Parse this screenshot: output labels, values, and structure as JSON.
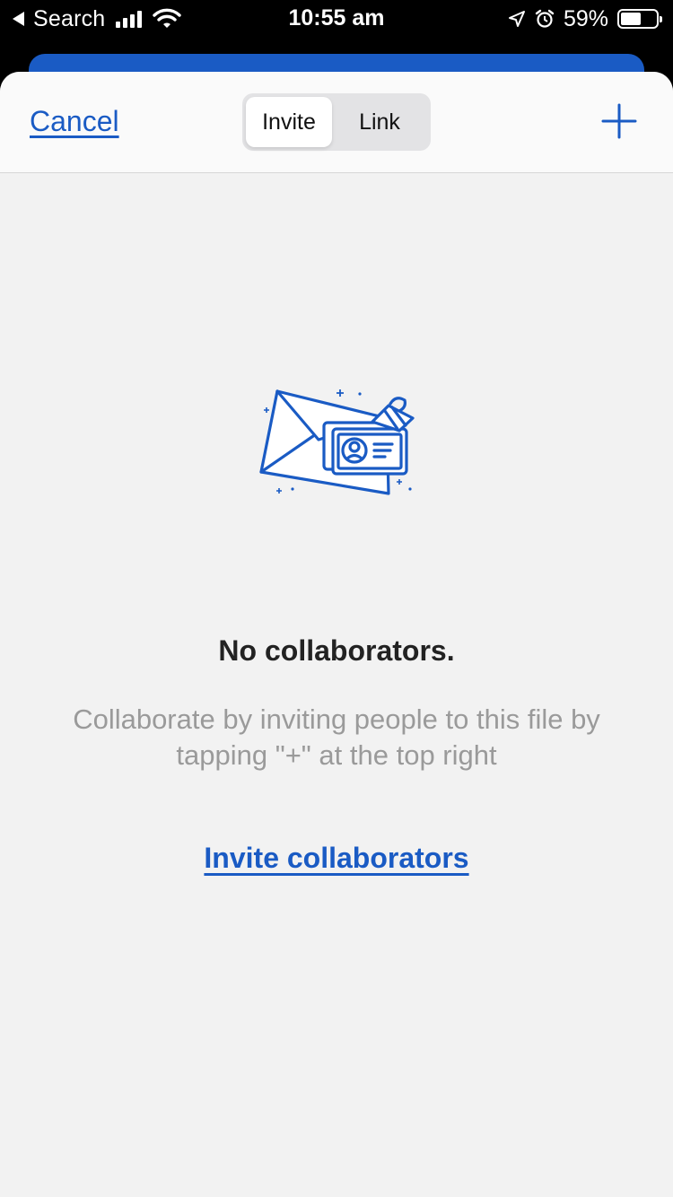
{
  "status_bar": {
    "back_label": "Search",
    "time": "10:55 am",
    "battery_percent_text": "59%",
    "battery_level": 0.59
  },
  "nav": {
    "cancel_label": "Cancel",
    "segments": [
      "Invite",
      "Link"
    ],
    "selected_segment": "Invite",
    "add_icon": "plus-icon"
  },
  "empty_state": {
    "illustration_icon": "envelope-contact-card-icon",
    "title": "No collaborators.",
    "description": "Collaborate by inviting people to this file by tapping \"+\" at the top right",
    "action_label": "Invite collaborators"
  },
  "colors": {
    "accent": "#1a5bc4",
    "sheet_background": "#f2f2f2",
    "muted_text": "#9a9a9a"
  }
}
